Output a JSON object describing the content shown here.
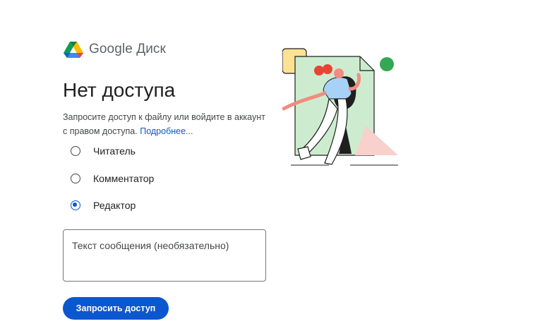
{
  "brand": {
    "name": "Google Диск",
    "logo_icon": "google-drive-logo-icon"
  },
  "title": "Нет доступа",
  "description": {
    "text": "Запросите доступ к файлу или войдите в аккаунт с правом доступа.",
    "link": "Подробнее..."
  },
  "roles": [
    {
      "label": "Читатель",
      "selected": false
    },
    {
      "label": "Комментатор",
      "selected": false
    },
    {
      "label": "Редактор",
      "selected": true
    }
  ],
  "message": {
    "placeholder": "Текст сообщения (необязательно)"
  },
  "request_button": {
    "label": "Запросить доступ"
  },
  "colors": {
    "accent": "#0b57d0",
    "illustration_green": "#34a853",
    "doc_green": "#cdeccf",
    "pink": "#f8d0cc",
    "shirt": "#a8d1f8",
    "hair": "#ea4335"
  }
}
